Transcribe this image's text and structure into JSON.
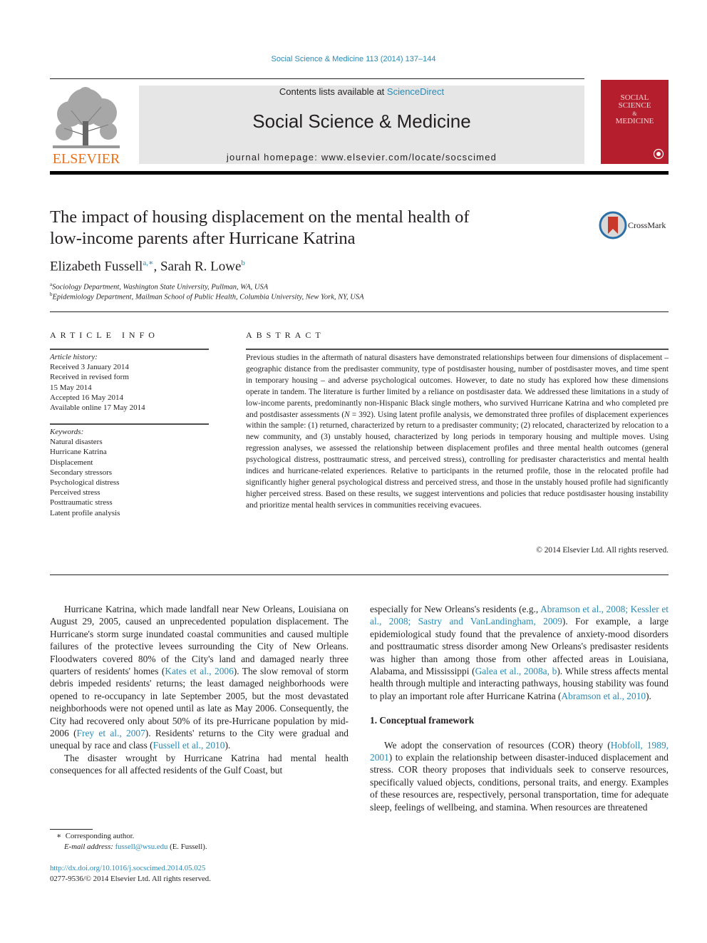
{
  "header": {
    "citation": "Social Science & Medicine 113 (2014) 137–144",
    "contents_prefix": "Contents lists available at ",
    "contents_link": "ScienceDirect",
    "journal_name": "Social Science & Medicine",
    "homepage": "journal homepage: www.elsevier.com/locate/socscimed",
    "publisher_logo_text": "ELSEVIER",
    "cover_text": [
      "SOCIAL",
      "SCIENCE",
      "&",
      "MEDICINE"
    ],
    "crossmark_label": "CrossMark",
    "colors": {
      "link": "#2a8ab5",
      "cover": "#b51f2d",
      "banner": "#e6e6e6",
      "elsevier_orange": "#e9711c"
    }
  },
  "article": {
    "title_line1": "The impact of housing displacement on the mental health of",
    "title_line2": "low-income parents after Hurricane Katrina",
    "authors": [
      {
        "name": "Elizabeth Fussell",
        "sup": "a,∗"
      },
      {
        "name": "Sarah R. Lowe",
        "sup": "b"
      }
    ],
    "affiliations": [
      {
        "key": "a",
        "text": "Sociology Department, Washington State University, Pullman, WA, USA"
      },
      {
        "key": "b",
        "text": "Epidemiology Department, Mailman School of Public Health, Columbia University, New York, NY, USA"
      }
    ]
  },
  "article_info": {
    "heading": "ARTICLE INFO",
    "history_label": "Article history:",
    "history": [
      "Received 3 January 2014",
      "Received in revised form",
      "15 May 2014",
      "Accepted 16 May 2014",
      "Available online 17 May 2014"
    ],
    "keywords_label": "Keywords:",
    "keywords": [
      "Natural disasters",
      "Hurricane Katrina",
      "Displacement",
      "Secondary stressors",
      "Psychological distress",
      "Perceived stress",
      "Posttraumatic stress",
      "Latent profile analysis"
    ]
  },
  "abstract": {
    "heading": "ABSTRACT",
    "text_part1": "Previous studies in the aftermath of natural disasters have demonstrated relationships between four dimensions of displacement – geographic distance from the predisaster community, type of postdisaster housing, number of postdisaster moves, and time spent in temporary housing – and adverse psychological outcomes. However, to date no study has explored how these dimensions operate in tandem. The literature is further limited by a reliance on postdisaster data. We addressed these limitations in a study of low-income parents, predominantly non-Hispanic Black single mothers, who survived Hurricane Katrina and who completed pre and postdisaster assessments (",
    "n_symbol": "N",
    "text_part2": " = 392). Using latent profile analysis, we demonstrated three profiles of displacement experiences within the sample: (1) returned, characterized by return to a predisaster community; (2) relocated, characterized by relocation to a new community, and (3) unstably housed, characterized by long periods in temporary housing and multiple moves. Using regression analyses, we assessed the relationship between displacement profiles and three mental health outcomes (general psychological distress, posttraumatic stress, and perceived stress), controlling for predisaster characteristics and mental health indices and hurricane-related experiences. Relative to participants in the returned profile, those in the relocated profile had significantly higher general psychological distress and perceived stress, and those in the unstably housed profile had significantly higher perceived stress. Based on these results, we suggest interventions and policies that reduce postdisaster housing instability and prioritize mental health services in communities receiving evacuees.",
    "copyright": "© 2014 Elsevier Ltd. All rights reserved."
  },
  "body": {
    "col1_p1": [
      {
        "t": "Hurricane Katrina, which made landfall near New Orleans, Louisiana on August 29, 2005, caused an unprecedented population displacement. The Hurricane's storm surge inundated coastal communities and caused multiple failures of the protective levees surrounding the City of New Orleans. Floodwaters covered 80% of the City's land and damaged nearly three quarters of residents' homes ("
      },
      {
        "t": "Kates et al., 2006",
        "link": true
      },
      {
        "t": "). The slow removal of storm debris impeded residents' returns; the least damaged neighborhoods were opened to re-occupancy in late September 2005, but the most devastated neighborhoods were not opened until as late as May 2006. Consequently, the City had recovered only about 50% of its pre-Hurricane population by mid-2006 ("
      },
      {
        "t": "Frey et al., 2007",
        "link": true
      },
      {
        "t": "). Residents' returns to the City were gradual and unequal by race and class ("
      },
      {
        "t": "Fussell et al., 2010",
        "link": true
      },
      {
        "t": ")."
      }
    ],
    "col1_p2": "The disaster wrought by Hurricane Katrina had mental health consequences for all affected residents of the Gulf Coast, but",
    "col2_p1": [
      {
        "t": "especially for New Orleans's residents (e.g., "
      },
      {
        "t": "Abramson et al., 2008; Kessler et al., 2008; Sastry and VanLandingham, 2009",
        "link": true
      },
      {
        "t": "). For example, a large epidemiological study found that the prevalence of anxiety-mood disorders and posttraumatic stress disorder among New Orleans's predisaster residents was higher than among those from other affected areas in Louisiana, Alabama, and Mississippi ("
      },
      {
        "t": "Galea et al., 2008a, b",
        "link": true
      },
      {
        "t": "). While stress affects mental health through multiple and interacting pathways, housing stability was found to play an important role after Hurricane Katrina ("
      },
      {
        "t": "Abramson et al., 2010",
        "link": true
      },
      {
        "t": ")."
      }
    ],
    "section1_heading": "1.  Conceptual framework",
    "col2_p2": [
      {
        "t": "We adopt the conservation of resources (COR) theory ("
      },
      {
        "t": "Hobfoll, 1989, 2001",
        "link": true
      },
      {
        "t": ") to explain the relationship between disaster-induced displacement and stress. COR theory proposes that individuals seek to conserve resources, specifically valued objects, conditions, personal traits, and energy. Examples of these resources are, respectively, personal transportation, time for adequate sleep, feelings of wellbeing, and stamina. When resources are threatened"
      }
    ]
  },
  "footnote": {
    "marker": "∗",
    "corresponding": "Corresponding author.",
    "email_label": "E-mail address: ",
    "email": "fussell@wsu.edu",
    "email_suffix": " (E. Fussell)."
  },
  "footer": {
    "doi": "http://dx.doi.org/10.1016/j.socscimed.2014.05.025",
    "issn": "0277-9536/© 2014 Elsevier Ltd. All rights reserved."
  }
}
